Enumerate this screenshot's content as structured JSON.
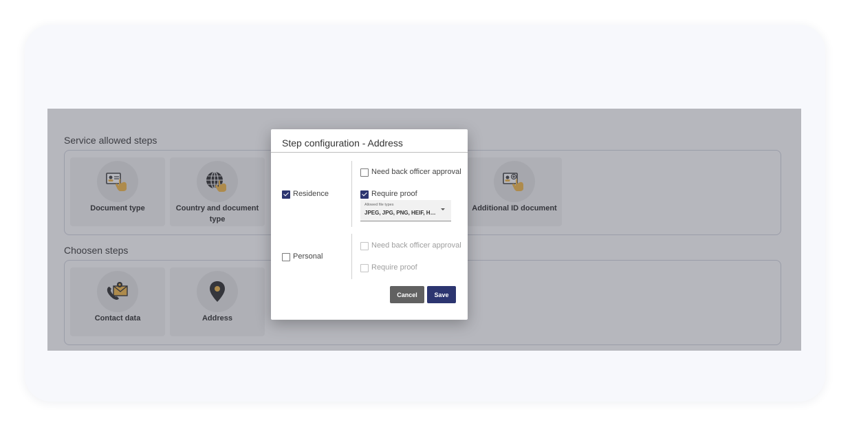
{
  "sections": {
    "allowed_title": "Service allowed steps",
    "chosen_title": "Choosen steps"
  },
  "allowed_steps": [
    {
      "label": "Document type",
      "icon": "id-card-hand-icon"
    },
    {
      "label": "Country and document type",
      "icon": "globe-hand-icon"
    },
    {
      "label": "Additional ID document",
      "icon": "id-card-plus-icon"
    }
  ],
  "chosen_steps": [
    {
      "label": "Contact data",
      "icon": "phone-envelope-icon"
    },
    {
      "label": "Address",
      "icon": "map-pin-icon"
    }
  ],
  "modal": {
    "title": "Step configuration - Address",
    "groups": {
      "residence": {
        "label": "Residence",
        "checked": true,
        "need_approval": {
          "label": "Need back officer approval",
          "checked": false
        },
        "require_proof": {
          "label": "Require proof",
          "checked": true
        },
        "file_types": {
          "caption": "Allowed file types",
          "value": "JPEG, JPG, PNG, HEIF, HEIC, PDF"
        }
      },
      "personal": {
        "label": "Personal",
        "checked": false,
        "need_approval": {
          "label": "Need back officer approval",
          "checked": false,
          "disabled": true
        },
        "require_proof": {
          "label": "Require proof",
          "checked": false,
          "disabled": true
        }
      }
    },
    "buttons": {
      "cancel": "Cancel",
      "save": "Save"
    }
  },
  "colors": {
    "primary": "#2c3570",
    "cancel": "#616161",
    "accent_yellow": "#f2b33d",
    "icon_dark": "#222222"
  }
}
